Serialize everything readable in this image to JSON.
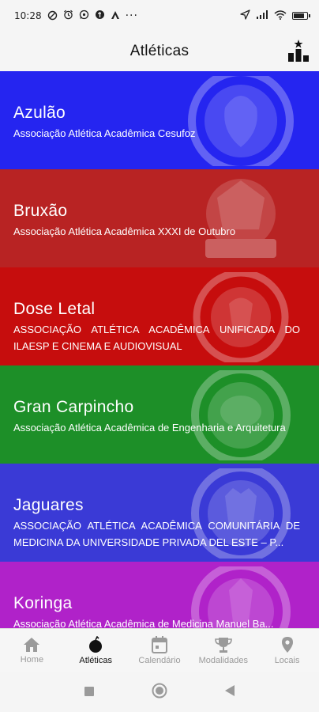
{
  "status_bar": {
    "time": "10:28",
    "left_icons": [
      "blocked-icon",
      "alarm-icon",
      "whatsapp-icon",
      "vpn-icon",
      "signal-a-icon",
      "more-dots-icon"
    ],
    "right_icons": [
      "location-arrow-icon",
      "signal-icon",
      "wifi-icon",
      "battery-icon"
    ],
    "more_glyph": "···",
    "battery_level": 0.8
  },
  "app_bar": {
    "title": "Atléticas",
    "action_icon": "ranking-podium-icon"
  },
  "atleticas": [
    {
      "name": "Azulão",
      "description": "Associação Atlética Acadêmica Cesufoz",
      "color": "#2525f0",
      "logo_icon": "azulao-logo-icon"
    },
    {
      "name": "Bruxão",
      "description": "Associação Atlética Acadêmica XXXI de Outubro",
      "color": "#b82323",
      "logo_icon": "bruxao-logo-icon"
    },
    {
      "name": "Dose Letal",
      "description": "ASSOCIAÇÃO ATLÉTICA ACADÊMICA UNIFICADA DO ILAESP E CINEMA E AUDIOVISUAL",
      "color": "#c60d0d",
      "logo_icon": "dose-letal-logo-icon"
    },
    {
      "name": "Gran Carpincho",
      "description": "Associação Atlética Acadêmica de Engenharia e Arquitetura",
      "color": "#1d8f28",
      "logo_icon": "gran-carpincho-logo-icon"
    },
    {
      "name": "Jaguares",
      "description": "ASSOCIAÇÃO ATLÉTICA ACADÊMICA COMUNITÁRIA DE MEDICINA DA UNIVERSIDADE PRIVADA DEL ESTE – P...",
      "color": "#3a3ad6",
      "logo_icon": "jaguares-logo-icon"
    },
    {
      "name": "Koringa",
      "description": "Associação Atlética Acadêmica de Medicina Manuel Ba...",
      "color": "#b022c9",
      "logo_icon": "koringa-logo-icon"
    }
  ],
  "bottom_nav": {
    "items": [
      {
        "label": "Home",
        "icon": "home-icon",
        "active": false
      },
      {
        "label": "Atléticas",
        "icon": "atleticas-icon",
        "active": true
      },
      {
        "label": "Calendário",
        "icon": "calendar-icon",
        "active": false
      },
      {
        "label": "Modalidades",
        "icon": "trophy-icon",
        "active": false
      },
      {
        "label": "Locais",
        "icon": "location-pin-icon",
        "active": false
      }
    ],
    "active_color": "#111111",
    "inactive_color": "#9a9a9a"
  },
  "system_nav": {
    "buttons": [
      "recents-square-icon",
      "home-circle-icon",
      "back-triangle-icon"
    ]
  }
}
